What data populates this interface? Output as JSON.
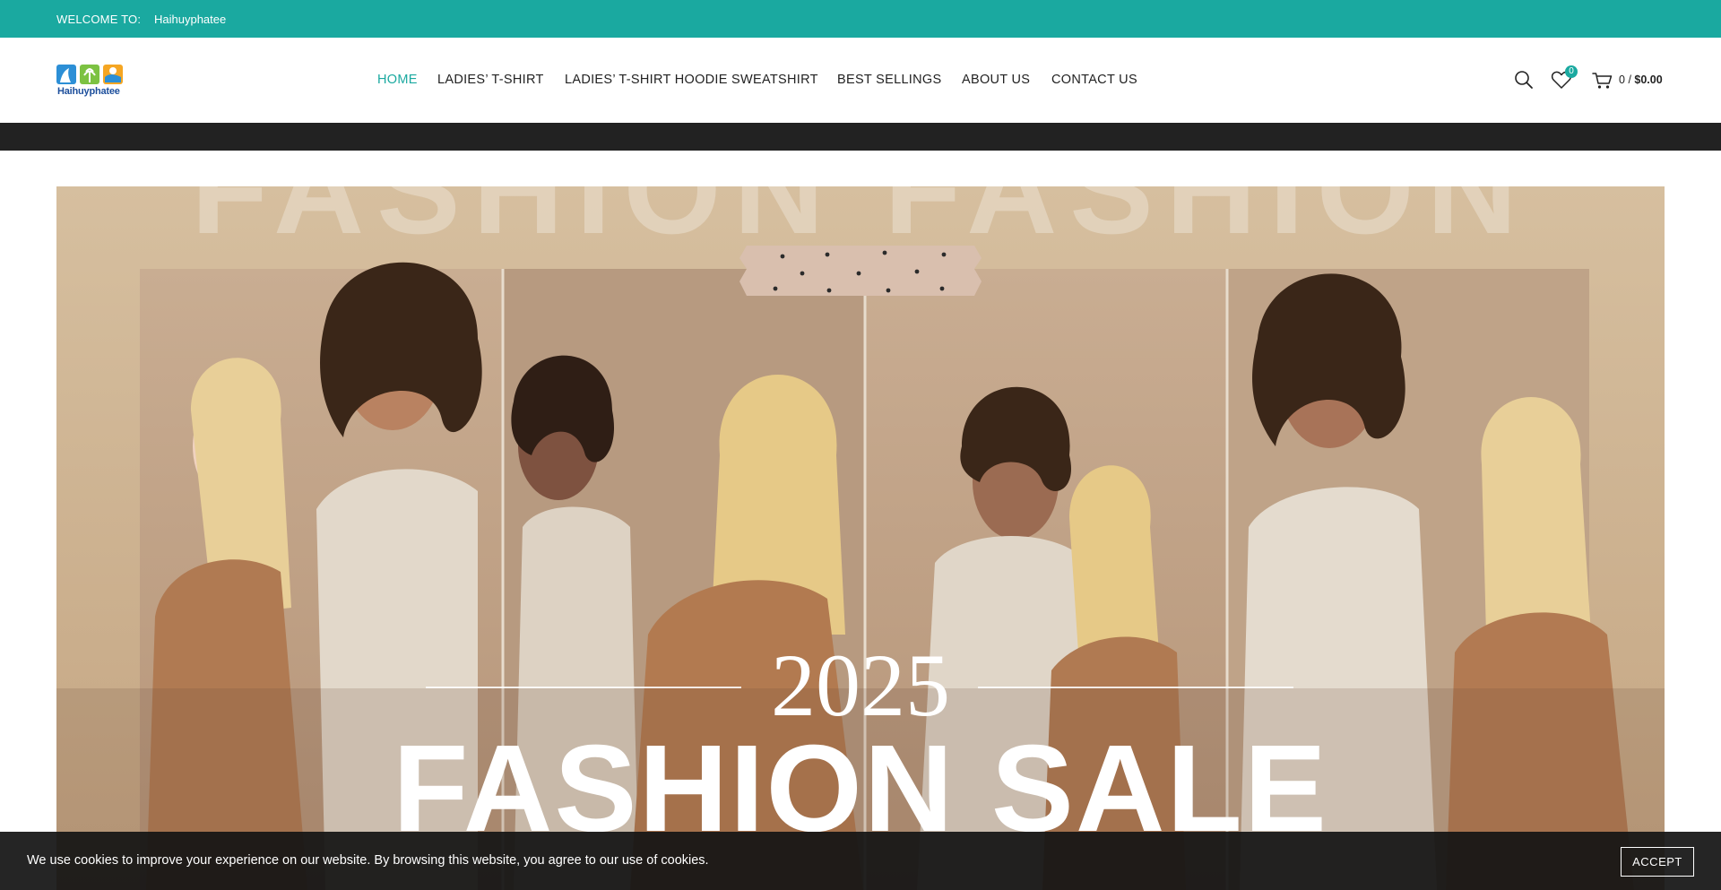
{
  "topbar": {
    "welcome_label": "WELCOME TO:",
    "site_name": "Haihuyphatee",
    "background_color": "#1aa9a0"
  },
  "header": {
    "logo_text": "Haihuyphatee",
    "nav": [
      {
        "label": "HOME",
        "active": true
      },
      {
        "label": "LADIES’ T-SHIRT",
        "active": false
      },
      {
        "label": "LADIES’ T-SHIRT HOODIE SWEATSHIRT",
        "active": false
      },
      {
        "label": "BEST SELLINGS",
        "active": false
      },
      {
        "label": "ABOUT US",
        "active": false
      },
      {
        "label": "CONTACT US",
        "active": false
      }
    ],
    "icons": [
      "search-icon",
      "heart-icon",
      "cart-icon"
    ],
    "wishlist_count": "0",
    "cart_count": "0",
    "cart_separator": "/",
    "cart_total": "$0.00",
    "accent_color": "#1aa9a0"
  },
  "hero": {
    "year": "2025",
    "headline": "FASHION SALE",
    "background_text": "FASHION FASHION"
  },
  "cookie_notice": {
    "message": "We use cookies to improve your experience on our website. By browsing this website, you agree to our use of cookies.",
    "accept_label": "ACCEPT"
  }
}
